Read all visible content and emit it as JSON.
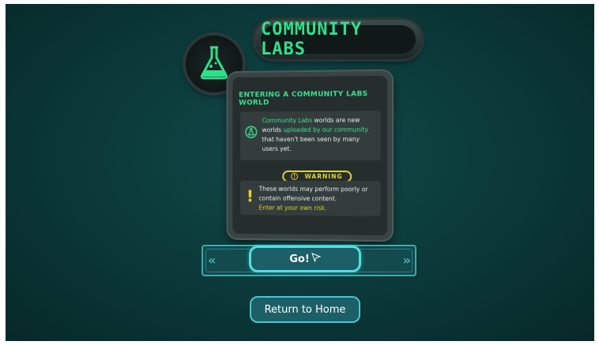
{
  "title": "COMMUNITY LABS",
  "emblem_icon": "flask-icon",
  "panel": {
    "heading": "ENTERING A COMMUNITY LABS WORLD",
    "info": {
      "icon": "community-labs-icon",
      "part1": "Community Labs",
      "part2": " worlds are new worlds ",
      "part3": "uploaded by our community",
      "part4": " that haven't been seen by many users yet."
    },
    "warning_label": "WARNING",
    "warning": {
      "line1": "These worlds may perform poorly or contain offensive content.",
      "line2": "Enter at your own risk."
    }
  },
  "go_label": "Go!",
  "home_label": "Return to Home",
  "colors": {
    "accent_green": "#2fe08a",
    "warning_yellow": "#e3d23a",
    "button_glow": "#4ee0e6"
  }
}
